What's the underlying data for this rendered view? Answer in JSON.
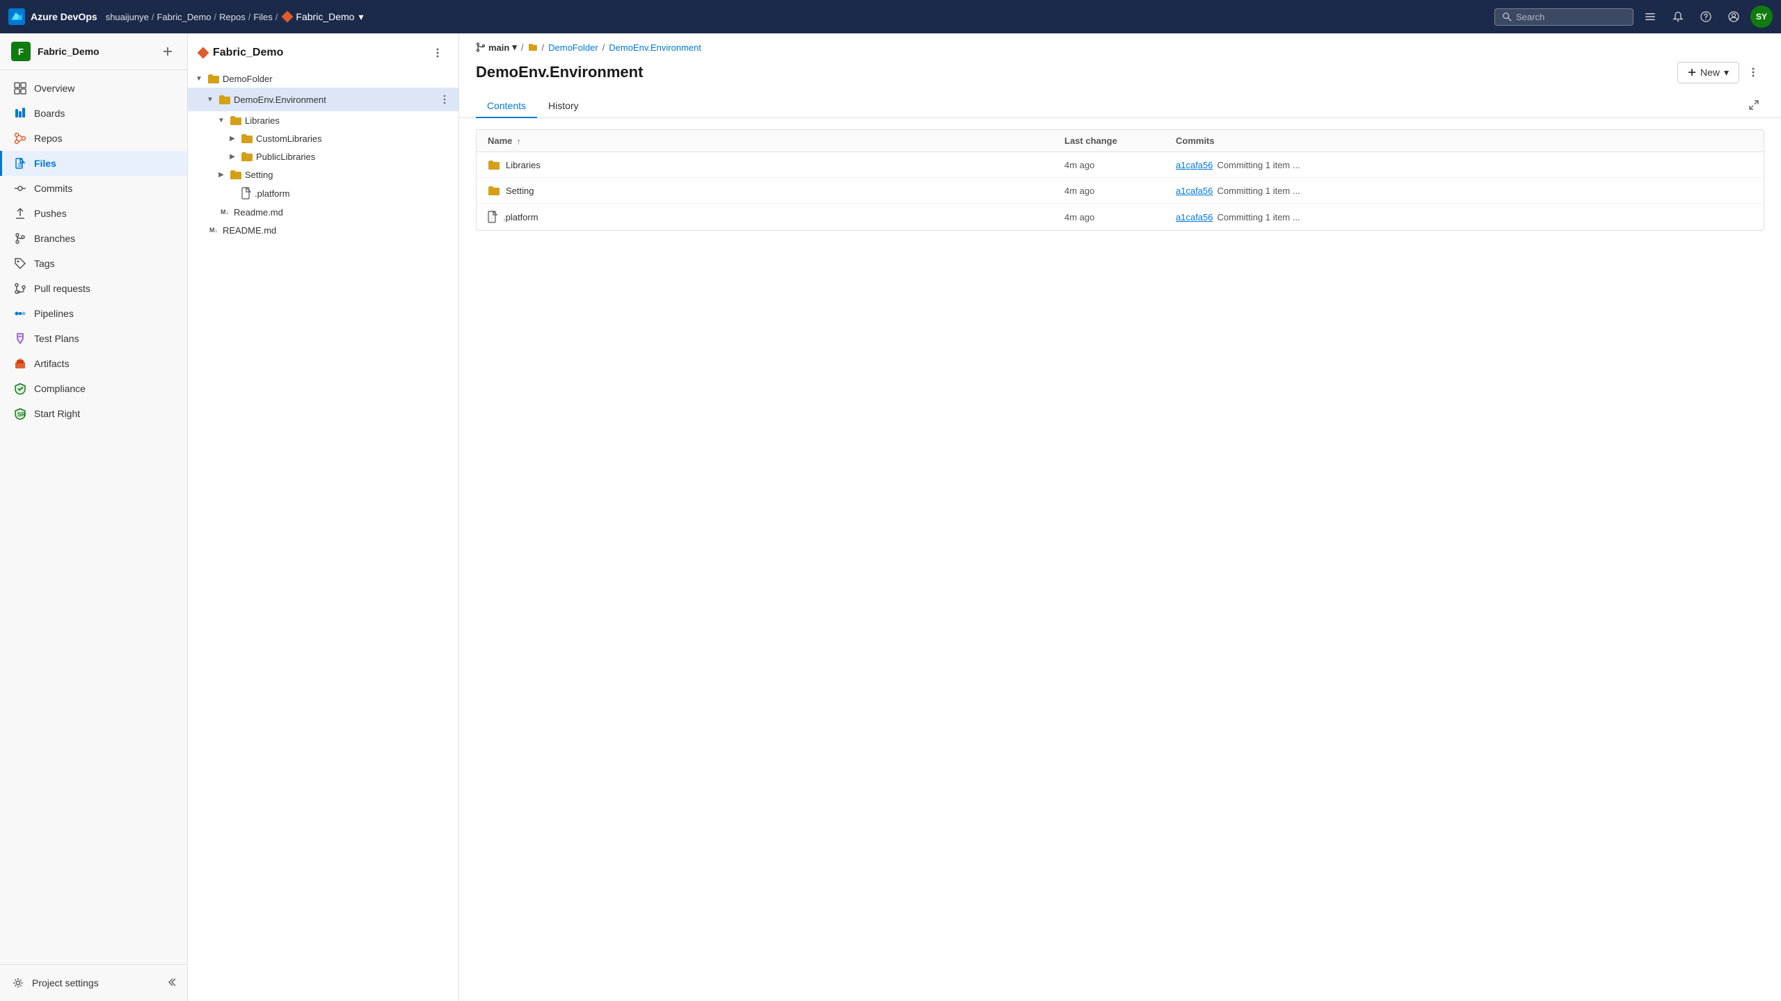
{
  "app": {
    "title": "Azure DevOps",
    "brand": "Azure DevOps"
  },
  "topnav": {
    "breadcrumbs": [
      "shuaijunye",
      "Fabric_Demo",
      "Repos",
      "Files"
    ],
    "current_repo": "Fabric_Demo",
    "search_placeholder": "Search",
    "avatar_initials": "SY"
  },
  "sidebar": {
    "project_name": "Fabric_Demo",
    "project_initial": "F",
    "items": [
      {
        "id": "overview",
        "label": "Overview",
        "icon": "overview"
      },
      {
        "id": "boards",
        "label": "Boards",
        "icon": "boards"
      },
      {
        "id": "repos",
        "label": "Repos",
        "icon": "repos"
      },
      {
        "id": "files",
        "label": "Files",
        "icon": "files",
        "active": true
      },
      {
        "id": "commits",
        "label": "Commits",
        "icon": "commits"
      },
      {
        "id": "pushes",
        "label": "Pushes",
        "icon": "pushes"
      },
      {
        "id": "branches",
        "label": "Branches",
        "icon": "branches"
      },
      {
        "id": "tags",
        "label": "Tags",
        "icon": "tags"
      },
      {
        "id": "pullrequests",
        "label": "Pull requests",
        "icon": "pullrequests"
      },
      {
        "id": "pipelines",
        "label": "Pipelines",
        "icon": "pipelines"
      },
      {
        "id": "testplans",
        "label": "Test Plans",
        "icon": "testplans"
      },
      {
        "id": "artifacts",
        "label": "Artifacts",
        "icon": "artifacts"
      },
      {
        "id": "compliance",
        "label": "Compliance",
        "icon": "compliance"
      },
      {
        "id": "startright",
        "label": "Start Right",
        "icon": "startright"
      }
    ],
    "bottom": {
      "project_settings_label": "Project settings"
    }
  },
  "filetree": {
    "repo_name": "Fabric_Demo",
    "items": [
      {
        "id": "demofolder",
        "name": "DemoFolder",
        "type": "folder",
        "level": 0,
        "expanded": true
      },
      {
        "id": "demoenv",
        "name": "DemoEnv.Environment",
        "type": "folder",
        "level": 1,
        "expanded": true,
        "selected": true
      },
      {
        "id": "libraries",
        "name": "Libraries",
        "type": "folder",
        "level": 2,
        "expanded": true
      },
      {
        "id": "customlibraries",
        "name": "CustomLibraries",
        "type": "folder",
        "level": 3,
        "expanded": false
      },
      {
        "id": "publiclibraries",
        "name": "PublicLibraries",
        "type": "folder",
        "level": 3,
        "expanded": false
      },
      {
        "id": "setting",
        "name": "Setting",
        "type": "folder",
        "level": 2,
        "expanded": false
      },
      {
        "id": "platform",
        "name": ".platform",
        "type": "file",
        "level": 2
      },
      {
        "id": "readmemd",
        "name": "Readme.md",
        "type": "markdown",
        "level": 1
      },
      {
        "id": "readmemd2",
        "name": "README.md",
        "type": "markdown",
        "level": 0
      }
    ]
  },
  "content": {
    "branch": "main",
    "breadcrumb": [
      "DemoFolder",
      "DemoEnv.Environment"
    ],
    "title": "DemoEnv.Environment",
    "new_button": "New",
    "tabs": [
      {
        "id": "contents",
        "label": "Contents",
        "active": true
      },
      {
        "id": "history",
        "label": "History",
        "active": false
      }
    ],
    "table": {
      "columns": [
        "Name",
        "Last change",
        "Commits"
      ],
      "rows": [
        {
          "id": "libraries-row",
          "name": "Libraries",
          "type": "folder",
          "last_change": "4m ago",
          "commit_hash": "a1cafa56",
          "commit_msg": "Committing 1 item ..."
        },
        {
          "id": "setting-row",
          "name": "Setting",
          "type": "folder",
          "last_change": "4m ago",
          "commit_hash": "a1cafa56",
          "commit_msg": "Committing 1 item ..."
        },
        {
          "id": "platform-row",
          "name": ".platform",
          "type": "file",
          "last_change": "4m ago",
          "commit_hash": "a1cafa56",
          "commit_msg": "Committing 1 item ..."
        }
      ]
    }
  }
}
